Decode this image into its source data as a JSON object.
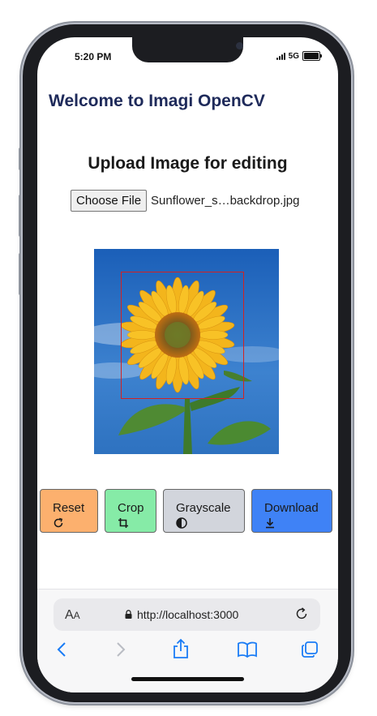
{
  "status_bar": {
    "time": "5:20 PM",
    "network": "5G"
  },
  "app": {
    "title": "Welcome to Imagi OpenCV",
    "upload_heading": "Upload Image for editing",
    "file_input": {
      "button_label": "Choose File",
      "file_name": "Sunflower_s…backdrop.jpg"
    }
  },
  "buttons": {
    "reset": {
      "label": "Reset",
      "icon": "refresh-icon",
      "color": "#fcb06e"
    },
    "crop": {
      "label": "Crop",
      "icon": "crop-icon",
      "color": "#86eba7"
    },
    "grayscale": {
      "label": "Grayscale",
      "icon": "contrast-icon",
      "color": "#d2d5dc"
    },
    "download": {
      "label": "Download",
      "icon": "download-icon",
      "color": "#3f82f6"
    }
  },
  "browser": {
    "text_size_label_big": "A",
    "text_size_label_small": "A",
    "url": "http://localhost:3000"
  },
  "colors": {
    "title": "#1e2a5a",
    "crop_box": "#d22222",
    "safari_accent": "#1a7cf5"
  }
}
